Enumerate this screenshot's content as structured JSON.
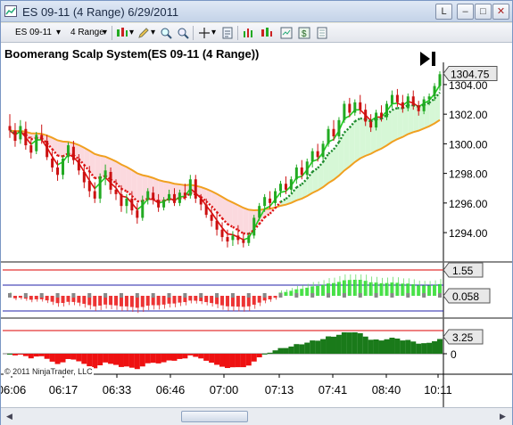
{
  "window": {
    "title": "ES 09-11 (4 Range)  6/29/2011",
    "buttons": [
      "L",
      "–",
      "□",
      "✕"
    ]
  },
  "toolbar": {
    "instrument": "ES 09-11",
    "period": "4 Range"
  },
  "chart_data": {
    "type": "candlestick",
    "title": "Boomerang Scalp System(ES 09-11 (4 Range))",
    "copyright": "© 2011 NinjaTrader, LLC",
    "price_panel": {
      "ylim": [
        1292.5,
        1305.5
      ],
      "yticks": [
        "1294.00",
        "1296.00",
        "1298.00",
        "1300.00",
        "1302.00",
        "1304.00"
      ],
      "last_price": "1304.75",
      "bars": [
        [
          1301.2,
          1302.0,
          1300.4,
          1300.9
        ],
        [
          1300.9,
          1301.4,
          1299.8,
          1300.2
        ],
        [
          1300.3,
          1301.6,
          1300.0,
          1301.2
        ],
        [
          1301.0,
          1301.5,
          1299.6,
          1299.9
        ],
        [
          1299.9,
          1300.5,
          1299.0,
          1299.4
        ],
        [
          1299.5,
          1300.8,
          1299.3,
          1300.6
        ],
        [
          1300.6,
          1301.3,
          1300.0,
          1300.3
        ],
        [
          1300.2,
          1300.6,
          1298.9,
          1299.1
        ],
        [
          1299.0,
          1299.5,
          1298.1,
          1298.4
        ],
        [
          1298.4,
          1298.9,
          1297.5,
          1297.9
        ],
        [
          1297.9,
          1299.2,
          1297.6,
          1299.0
        ],
        [
          1299.1,
          1300.1,
          1298.7,
          1299.9
        ],
        [
          1299.8,
          1300.2,
          1298.6,
          1298.9
        ],
        [
          1298.9,
          1299.3,
          1297.9,
          1298.2
        ],
        [
          1298.1,
          1298.6,
          1297.0,
          1297.4
        ],
        [
          1297.5,
          1298.5,
          1296.4,
          1296.8
        ],
        [
          1296.8,
          1297.4,
          1296.0,
          1296.3
        ],
        [
          1296.3,
          1298.0,
          1296.0,
          1297.8
        ],
        [
          1297.7,
          1298.6,
          1297.2,
          1298.2
        ],
        [
          1298.1,
          1298.4,
          1296.6,
          1296.9
        ],
        [
          1296.9,
          1297.6,
          1296.2,
          1296.6
        ],
        [
          1296.6,
          1297.2,
          1295.4,
          1295.8
        ],
        [
          1295.8,
          1296.6,
          1295.3,
          1296.3
        ],
        [
          1296.3,
          1296.8,
          1295.2,
          1295.5
        ],
        [
          1295.5,
          1296.0,
          1294.6,
          1295.0
        ],
        [
          1295.0,
          1296.5,
          1294.8,
          1296.2
        ],
        [
          1296.2,
          1297.0,
          1295.9,
          1296.8
        ],
        [
          1296.7,
          1297.1,
          1295.9,
          1296.2
        ],
        [
          1296.2,
          1296.6,
          1295.4,
          1295.7
        ],
        [
          1295.7,
          1296.4,
          1295.5,
          1296.2
        ],
        [
          1296.2,
          1296.9,
          1296.0,
          1296.6
        ],
        [
          1296.6,
          1297.0,
          1295.8,
          1296.0
        ],
        [
          1296.0,
          1296.9,
          1295.8,
          1296.7
        ],
        [
          1296.7,
          1297.3,
          1296.2,
          1296.5
        ],
        [
          1296.5,
          1297.9,
          1296.3,
          1297.6
        ],
        [
          1297.6,
          1297.9,
          1296.0,
          1296.3
        ],
        [
          1296.3,
          1296.6,
          1295.5,
          1295.9
        ],
        [
          1295.9,
          1296.3,
          1295.0,
          1295.2
        ],
        [
          1295.2,
          1295.7,
          1294.4,
          1294.8
        ],
        [
          1294.8,
          1295.3,
          1293.8,
          1294.2
        ],
        [
          1294.2,
          1294.7,
          1293.4,
          1293.7
        ],
        [
          1293.7,
          1294.2,
          1293.0,
          1293.4
        ],
        [
          1293.5,
          1294.1,
          1293.1,
          1293.8
        ],
        [
          1293.8,
          1294.5,
          1293.2,
          1293.5
        ],
        [
          1293.5,
          1294.0,
          1293.0,
          1293.3
        ],
        [
          1293.3,
          1294.0,
          1293.1,
          1293.8
        ],
        [
          1293.8,
          1295.2,
          1293.6,
          1295.0
        ],
        [
          1295.0,
          1296.0,
          1294.8,
          1295.8
        ],
        [
          1295.8,
          1296.6,
          1295.4,
          1296.4
        ],
        [
          1296.3,
          1296.8,
          1295.6,
          1296.0
        ],
        [
          1296.0,
          1297.0,
          1295.8,
          1296.8
        ],
        [
          1296.8,
          1297.5,
          1296.4,
          1297.3
        ],
        [
          1297.3,
          1297.8,
          1296.6,
          1296.9
        ],
        [
          1296.9,
          1297.8,
          1296.7,
          1297.6
        ],
        [
          1297.6,
          1298.6,
          1297.3,
          1298.4
        ],
        [
          1298.4,
          1298.9,
          1297.6,
          1297.9
        ],
        [
          1297.9,
          1299.0,
          1297.7,
          1298.8
        ],
        [
          1298.8,
          1299.7,
          1298.4,
          1299.5
        ],
        [
          1299.5,
          1300.0,
          1298.8,
          1299.1
        ],
        [
          1299.1,
          1300.2,
          1298.9,
          1300.0
        ],
        [
          1300.0,
          1301.2,
          1299.8,
          1301.0
        ],
        [
          1301.0,
          1301.6,
          1300.2,
          1300.5
        ],
        [
          1300.5,
          1301.8,
          1300.3,
          1301.6
        ],
        [
          1301.6,
          1302.9,
          1301.4,
          1302.7
        ],
        [
          1302.7,
          1303.1,
          1301.8,
          1302.1
        ],
        [
          1302.1,
          1303.0,
          1301.9,
          1302.8
        ],
        [
          1302.8,
          1303.3,
          1302.0,
          1302.3
        ],
        [
          1302.3,
          1302.7,
          1301.2,
          1301.5
        ],
        [
          1301.5,
          1302.0,
          1300.8,
          1301.1
        ],
        [
          1301.1,
          1302.3,
          1300.9,
          1302.1
        ],
        [
          1302.1,
          1302.6,
          1301.5,
          1301.8
        ],
        [
          1301.8,
          1302.9,
          1301.6,
          1302.7
        ],
        [
          1302.7,
          1303.6,
          1302.4,
          1303.3
        ],
        [
          1303.3,
          1303.7,
          1302.5,
          1302.8
        ],
        [
          1302.8,
          1303.3,
          1302.1,
          1302.4
        ],
        [
          1302.4,
          1303.4,
          1302.2,
          1303.2
        ],
        [
          1303.2,
          1303.6,
          1302.3,
          1302.6
        ],
        [
          1302.6,
          1302.9,
          1301.9,
          1302.2
        ],
        [
          1302.2,
          1303.2,
          1302.0,
          1303.0
        ],
        [
          1303.0,
          1303.4,
          1302.6,
          1303.2
        ],
        [
          1303.2,
          1304.1,
          1302.9,
          1303.9
        ],
        [
          1303.9,
          1304.9,
          1303.6,
          1304.7
        ]
      ]
    },
    "osc1_panel": {
      "label_top": "1.55",
      "label_val": "0.058"
    },
    "osc2_panel": {
      "label_top": "3.25",
      "label_zero": "0"
    },
    "xticks": [
      "06:06",
      "06:17",
      "06:33",
      "06:46",
      "07:00",
      "07:13",
      "07:41",
      "08:40",
      "10:11"
    ]
  }
}
